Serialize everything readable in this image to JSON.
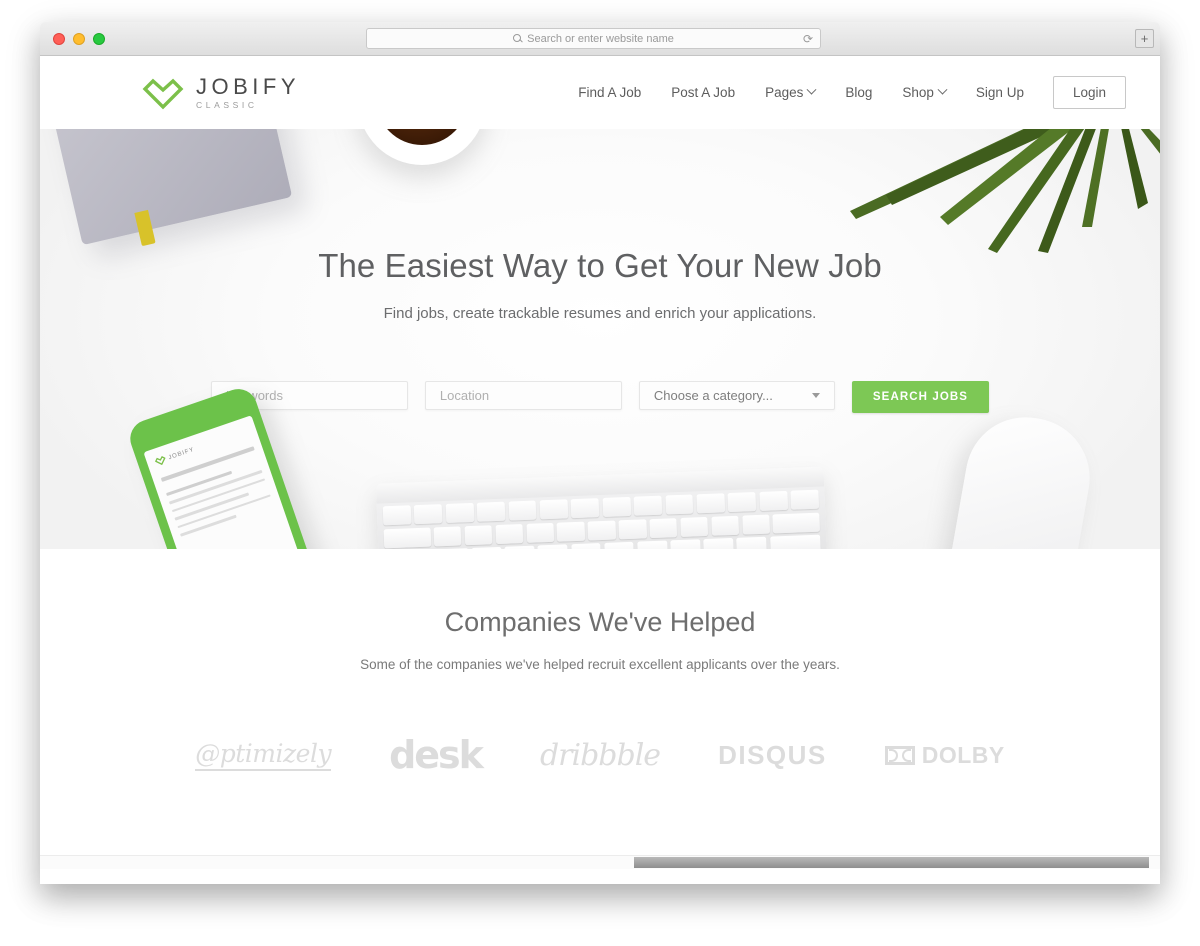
{
  "browser": {
    "address_placeholder": "Search or enter website name",
    "search_icon": "search-icon",
    "reload_icon": "reload-icon",
    "newtab_label": "+",
    "traffic_lights": [
      "close",
      "minimize",
      "maximize"
    ]
  },
  "header": {
    "logo": {
      "name": "JOBIFY",
      "tagline": "CLASSIC",
      "mark_color": "#7cc04a"
    },
    "nav": [
      {
        "label": "Find A Job",
        "has_caret": false
      },
      {
        "label": "Post A Job",
        "has_caret": false
      },
      {
        "label": "Pages",
        "has_caret": true
      },
      {
        "label": "Blog",
        "has_caret": false
      },
      {
        "label": "Shop",
        "has_caret": true
      },
      {
        "label": "Sign Up",
        "has_caret": false
      }
    ],
    "login_label": "Login"
  },
  "hero": {
    "title": "The Easiest Way to Get Your New Job",
    "subtitle": "Find jobs, create trackable resumes and enrich your applications.",
    "search": {
      "keywords_placeholder": "Keywords",
      "location_placeholder": "Location",
      "category_value": "Choose a category...",
      "button_label": "SEARCH JOBS",
      "button_color": "#7dc855"
    },
    "phone_screen": {
      "brand": "JOBIFY"
    }
  },
  "companies": {
    "title": "Companies We've Helped",
    "subtitle": "Some of the companies we've helped recruit excellent applicants over the years.",
    "logos": [
      {
        "name": "Optimizely",
        "text": "@ptimizely"
      },
      {
        "name": "desk",
        "text": "desk"
      },
      {
        "name": "dribbble",
        "text": "dribbble"
      },
      {
        "name": "DISQUS",
        "text": "DISQUS"
      },
      {
        "name": "DOLBY",
        "text": "DOLBY"
      }
    ]
  }
}
